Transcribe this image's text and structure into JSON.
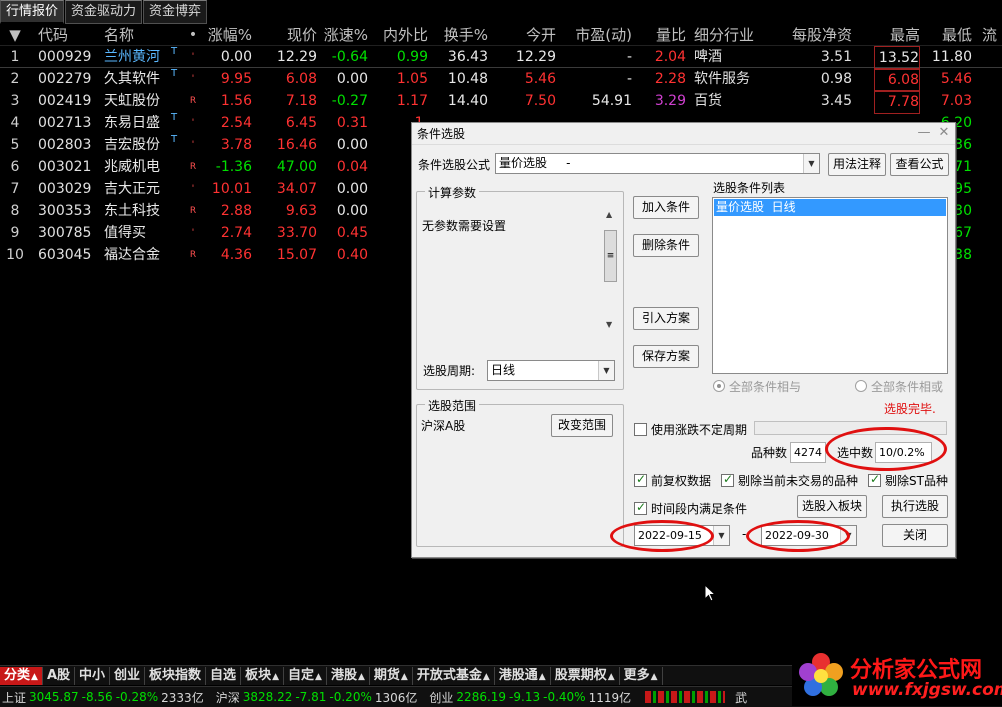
{
  "top_tabs": [
    "行情报价",
    "资金驱动力",
    "资金博弈"
  ],
  "table": {
    "header_arrow": "▼",
    "columns": [
      "代码",
      "名称",
      "•",
      "涨幅%",
      "现价",
      "涨速%",
      "内外比",
      "换手%",
      "今开",
      "市盈(动)",
      "量比",
      "细分行业",
      "每股净资",
      "最高",
      "最低",
      "流"
    ],
    "rows": [
      {
        "idx": "1",
        "code": "000929",
        "name": "兰州黄河",
        "mark": "T",
        "flag": "'",
        "chg": "0.00",
        "price": "12.29",
        "speed": "-0.64",
        "ratio": "0.99",
        "turn": "36.43",
        "open": "12.29",
        "pe": "-",
        "vr": "2.04",
        "ind": "啤酒",
        "nav": "3.51",
        "high": "13.52",
        "low": "11.80",
        "extra": ""
      },
      {
        "idx": "2",
        "code": "002279",
        "name": "久其软件",
        "mark": "T",
        "flag": "'",
        "chg": "9.95",
        "price": "6.08",
        "speed": "0.00",
        "ratio": "1.05",
        "turn": "10.48",
        "open": "5.46",
        "pe": "-",
        "vr": "2.28",
        "ind": "软件服务",
        "nav": "0.98",
        "high": "6.08",
        "low": "5.46",
        "extra": ""
      },
      {
        "idx": "3",
        "code": "002419",
        "name": "天虹股份",
        "mark": "",
        "flag": "R",
        "chg": "1.56",
        "price": "7.18",
        "speed": "-0.27",
        "ratio": "1.17",
        "turn": "14.40",
        "open": "7.50",
        "pe": "54.91",
        "vr": "3.29",
        "ind": "百货",
        "nav": "3.45",
        "high": "7.78",
        "low": "7.03",
        "extra": ""
      },
      {
        "idx": "4",
        "code": "002713",
        "name": "东易日盛",
        "mark": "T",
        "flag": "'",
        "chg": "2.54",
        "price": "6.45",
        "speed": "0.31",
        "ratio": "1.",
        "turn": "",
        "open": "",
        "pe": "",
        "vr": "",
        "ind": "",
        "nav": "",
        "high": "",
        "low": "6.20",
        "extra": ""
      },
      {
        "idx": "5",
        "code": "002803",
        "name": "吉宏股份",
        "mark": "T",
        "flag": "'",
        "chg": "3.78",
        "price": "16.46",
        "speed": "0.00",
        "ratio": "0.",
        "turn": "",
        "open": "",
        "pe": "",
        "vr": "",
        "ind": "",
        "nav": "",
        "high": "",
        "low": "36",
        "extra": ""
      },
      {
        "idx": "6",
        "code": "003021",
        "name": "兆威机电",
        "mark": "",
        "flag": "R",
        "chg": "-1.36",
        "price": "47.00",
        "speed": "0.04",
        "ratio": "0.",
        "turn": "",
        "open": "",
        "pe": "",
        "vr": "",
        "ind": "",
        "nav": "",
        "high": "",
        "low": "71",
        "extra": ""
      },
      {
        "idx": "7",
        "code": "003029",
        "name": "吉大正元",
        "mark": "",
        "flag": "'",
        "chg": "10.01",
        "price": "34.07",
        "speed": "0.00",
        "ratio": "0.",
        "turn": "",
        "open": "",
        "pe": "",
        "vr": "",
        "ind": "",
        "nav": "",
        "high": "",
        "low": "95",
        "extra": ""
      },
      {
        "idx": "8",
        "code": "300353",
        "name": "东土科技",
        "mark": "",
        "flag": "R",
        "chg": "2.88",
        "price": "9.63",
        "speed": "0.00",
        "ratio": "0.",
        "turn": "",
        "open": "",
        "pe": "",
        "vr": "",
        "ind": "",
        "nav": "",
        "high": "",
        "low": "30",
        "extra": ""
      },
      {
        "idx": "9",
        "code": "300785",
        "name": "值得买",
        "mark": "",
        "flag": "'",
        "chg": "2.74",
        "price": "33.70",
        "speed": "0.45",
        "ratio": "1.",
        "turn": "",
        "open": "",
        "pe": "",
        "vr": "",
        "ind": "",
        "nav": "",
        "high": "",
        "low": "67",
        "extra": ""
      },
      {
        "idx": "10",
        "code": "603045",
        "name": "福达合金",
        "mark": "",
        "flag": "R",
        "chg": "4.36",
        "price": "15.07",
        "speed": "0.40",
        "ratio": "0.",
        "turn": "",
        "open": "",
        "pe": "",
        "vr": "",
        "ind": "",
        "nav": "",
        "high": "",
        "low": "38",
        "extra": ""
      }
    ]
  },
  "dialog": {
    "title": "条件选股",
    "formula_label": "条件选股公式",
    "formula_value": "量价选股     -",
    "usage_btn": "用法注释",
    "view_btn": "查看公式",
    "params_group": "计算参数",
    "params_text": "无参数需要设置",
    "period_label": "选股周期:",
    "period_value": "日线",
    "add_btn": "加入条件",
    "delete_btn": "删除条件",
    "import_btn": "引入方案",
    "save_btn": "保存方案",
    "list_label": "选股条件列表",
    "list_items": [
      "量价选股  日线"
    ],
    "radio_and": "全部条件相与",
    "radio_or": "全部条件相或",
    "done_text": "选股完毕.",
    "range_group": "选股范围",
    "range_value": "沪深A股",
    "change_range_btn": "改变范围",
    "uncertain_period_label": "使用涨跌不定周期",
    "count_label": "品种数",
    "count_value": "4274",
    "selected_label": "选中数",
    "selected_value": "10/0.2%",
    "pre_adjust": "前复权数据",
    "exclude_untraded": "剔除当前未交易的品种",
    "exclude_st": "剔除ST品种",
    "time_range": "时间段内满足条件",
    "to_block_btn": "选股入板块",
    "execute_btn": "执行选股",
    "date_start": "2022-09-15",
    "date_sep": "-",
    "date_end": "2022-09-30",
    "close_btn": "关闭"
  },
  "bottom_tabs": [
    "分类",
    "A股",
    "中小",
    "创业",
    "板块指数",
    "自选",
    "板块",
    "自定",
    "港股",
    "期货",
    "开放式基金",
    "港股通",
    "股票期权",
    "更多"
  ],
  "status": [
    {
      "name": "上证",
      "val": "3045.87",
      "chg": "-8.56",
      "pct": "-0.28%",
      "amt": "2333亿"
    },
    {
      "name": "沪深",
      "val": "3828.22",
      "chg": "-7.81",
      "pct": "-0.20%",
      "amt": "1306亿"
    },
    {
      "name": "创业",
      "val": "2286.19",
      "chg": "-9.13",
      "pct": "-0.40%",
      "amt": "1119亿"
    }
  ],
  "status_tail": "武",
  "watermark": {
    "text": "分析家公式网",
    "url": "www.fxjgsw.com"
  },
  "colors": {
    "red": "#ff3232",
    "green": "#00e000",
    "accent": "#c81818",
    "highlight": "#3399ff",
    "ellipse": "#e01010"
  }
}
